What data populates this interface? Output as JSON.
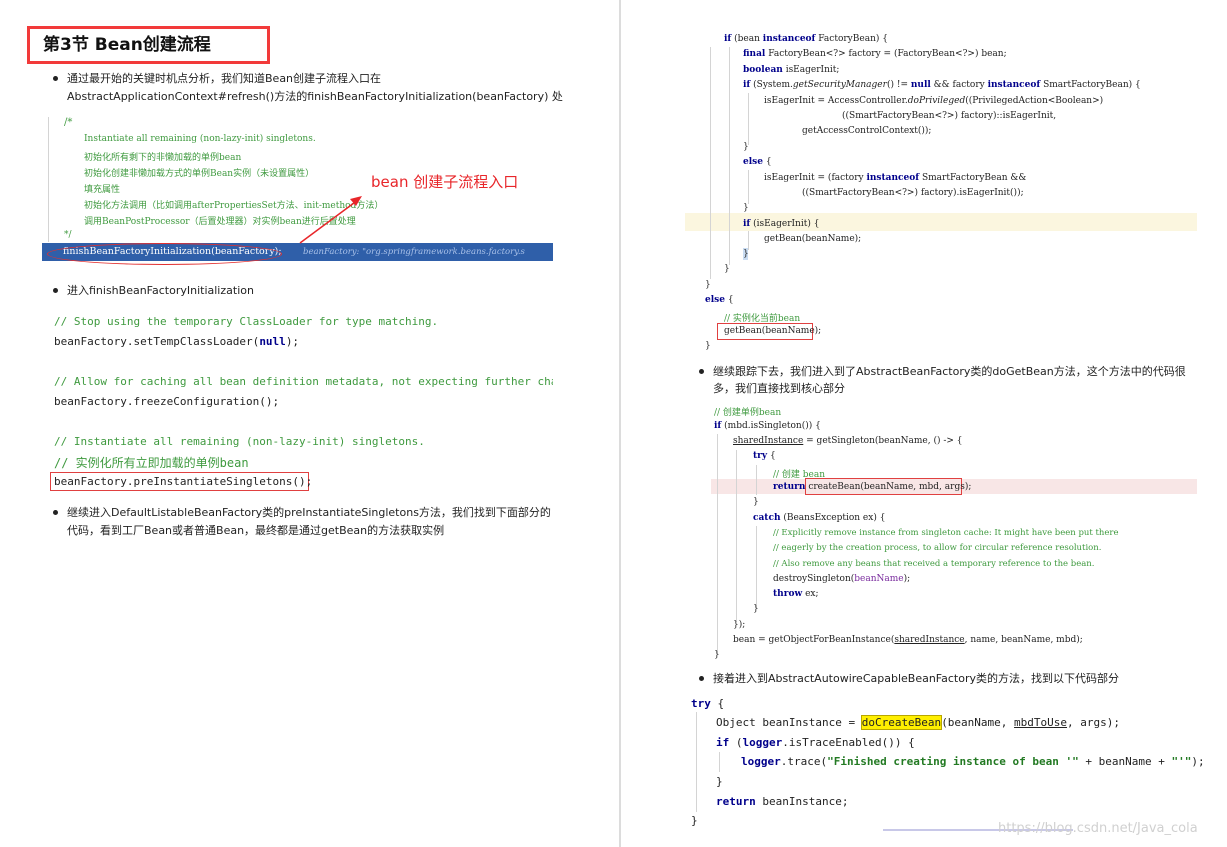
{
  "left": {
    "title": "第3节 Bean创建流程",
    "bullet1_line1": "通过最开始的关键时机点分析，我们知道Bean创建子流程入口在",
    "bullet1_line2": "AbstractApplicationContext#refresh()方法的finishBeanFactoryInitialization(beanFactory) 处",
    "code1": {
      "comment_open": "/*",
      "line1": "Instantiate all remaining (non-lazy-init) singletons.",
      "line2": "初始化所有剩下的非懒加载的单例bean",
      "line3": "初始化创建非懒加载方式的单例Bean实例（未设置属性）",
      "line4": "填充属性",
      "line5": "初始化方法调用（比如调用afterPropertiesSet方法、init-method方法）",
      "line6": "调用BeanPostProcessor（后置处理器）对实例bean进行后置处理",
      "comment_close": "*/",
      "highlight_call": "finishBeanFactoryInitialization(beanFactory);",
      "highlight_hint": "beanFactory: \"org.springframework.beans.factory.s"
    },
    "annotation": "bean 创建子流程入口",
    "bullet2": "进入finishBeanFactoryInitialization",
    "code2": {
      "c1": "// Stop using the temporary ClassLoader for type matching.",
      "l1a": "beanFactory.setTempClassLoader(",
      "l1b": "null",
      "l1c": ");",
      "c2": "// Allow for caching all bean definition metadata, not expecting further chang",
      "l2": "beanFactory.freezeConfiguration();",
      "c3": "// Instantiate all remaining (non-lazy-init) singletons.",
      "c4": "// 实例化所有立即加载的单例bean",
      "l3": "beanFactory.preInstantiateSingletons();"
    },
    "bullet3_line1": "继续进入DefaultListableBeanFactory类的preInstantiateSingletons方法，我们找到下面部分的",
    "bullet3_line2": "代码，看到工厂Bean或者普通Bean，最终都是通过getBean的方法获取实例"
  },
  "right": {
    "code3": {
      "r01a": "if",
      "r01b": " (bean ",
      "r01c": "instanceof",
      "r01d": " FactoryBean) {",
      "r02a": "final",
      "r02b": " FactoryBean<?> factory = (FactoryBean<?>) bean;",
      "r03a": "boolean",
      "r03b": " isEagerInit;",
      "r04a": "if",
      "r04b": " (System.",
      "r04c": "getSecurityManager",
      "r04d": "() != ",
      "r04e": "null",
      "r04f": " && factory ",
      "r04g": "instanceof",
      "r04h": " SmartFactoryBean) {",
      "r05a": "isEagerInit = AccessController.",
      "r05b": "doPrivileged",
      "r05c": "((PrivilegedAction<Boolean>)",
      "r06": "((SmartFactoryBean<?>) factory)::isEagerInit,",
      "r07": "getAccessControlContext());",
      "r08": "}",
      "r09a": "else",
      "r09b": " {",
      "r10a": "isEagerInit = (factory ",
      "r10b": "instanceof",
      "r10c": " SmartFactoryBean &&",
      "r11": "((SmartFactoryBean<?>) factory).isEagerInit());",
      "r12": "}",
      "r13a": "if",
      "r13b": " (isEagerInit) {",
      "r14": "getBean(beanName);",
      "r15": "}",
      "r16": "}",
      "r17": "}",
      "r18a": "else",
      "r18b": " {",
      "r19": "// 实例化当前bean",
      "r20": "getBean(beanName);",
      "r21": "}"
    },
    "bullet4_line1": "继续跟踪下去，我们进入到了AbstractBeanFactory类的doGetBean方法，这个方法中的代码很",
    "bullet4_line2": "多，我们直接找到核心部分",
    "code4": {
      "d01": "// 创建单例bean",
      "d02a": "if",
      "d02b": " (mbd.isSingleton()) {",
      "d03a": "sharedInstance",
      "d03b": " = getSingleton(beanName, () -> {",
      "d04a": "try",
      "d04b": " {",
      "d05": "// 创建 bean",
      "d06a": "return",
      "d06b": " createBean(beanName, mbd, args);",
      "d07": "}",
      "d08a": "catch",
      "d08b": " (BeansException ex) {",
      "d09": "// Explicitly remove instance from singleton cache: It might have been put there",
      "d10": "// eagerly by the creation process, to allow for circular reference resolution.",
      "d11": "// Also remove any beans that received a temporary reference to the bean.",
      "d12a": "destroySingleton(",
      "d12b": "beanName",
      "d12c": ");",
      "d13a": "throw",
      "d13b": " ex;",
      "d14": "}",
      "d15": "});",
      "d16a": "bean = getObjectForBeanInstance(",
      "d16b": "sharedInstance",
      "d16c": ", name, beanName, mbd);",
      "d17": "}"
    },
    "bullet5": "接着进入到AbstractAutowireCapableBeanFactory类的方法，找到以下代码部分",
    "code5": {
      "e01a": "try",
      "e01b": " {",
      "e02a": "Object beanInstance = ",
      "e02b": "doCreateBean",
      "e02c": "(beanName, ",
      "e02d": "mbdToUse",
      "e02e": ", args);",
      "e03a": "if",
      "e03b": " (",
      "e03c": "logger",
      "e03d": ".isTraceEnabled()) {",
      "e04a": "logger",
      "e04b": ".trace(",
      "e04c": "\"Finished creating instance of bean '\"",
      "e04d": " + beanName + ",
      "e04e": "\"'\"",
      "e04f": ");",
      "e05": "}",
      "e06a": "return",
      "e06b": " beanInstance;",
      "e07": "}"
    },
    "watermark": "https://blog.csdn.net/Java_cola"
  }
}
